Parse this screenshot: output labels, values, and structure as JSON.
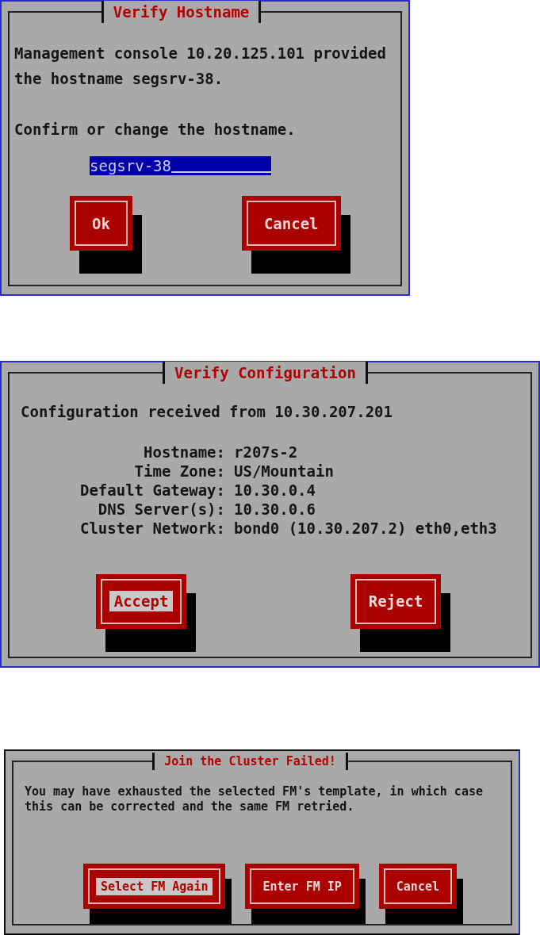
{
  "dialogs": [
    {
      "title": "Verify Hostname",
      "message": "Management console 10.20.125.101 provided the hostname segsrv-38.",
      "prompt": "Confirm or change the hostname.",
      "field": {
        "value": "segsrv-38"
      },
      "buttons": [
        {
          "label": "Ok",
          "selected": false
        },
        {
          "label": "Cancel",
          "selected": false
        }
      ]
    },
    {
      "title": "Verify Configuration",
      "message": "Configuration received from 10.30.207.201",
      "rows": [
        {
          "label": "Hostname:",
          "value": "r207s-2"
        },
        {
          "label": "Time Zone:",
          "value": "US/Mountain"
        },
        {
          "label": "Default Gateway:",
          "value": "10.30.0.4"
        },
        {
          "label": "DNS Server(s):",
          "value": "10.30.0.6"
        },
        {
          "label": "Cluster Network:",
          "value": "bond0 (10.30.207.2) eth0,eth3"
        }
      ],
      "buttons": [
        {
          "label": "Accept",
          "selected": true
        },
        {
          "label": "Reject",
          "selected": false
        }
      ]
    },
    {
      "title": "Join the Cluster Failed!",
      "message": "You may have exhausted the selected FM's template, in which case this can be corrected and the same FM retried.",
      "buttons": [
        {
          "label": "Select FM Again",
          "selected": true
        },
        {
          "label": "Enter FM IP",
          "selected": false
        },
        {
          "label": "Cancel",
          "selected": false
        }
      ]
    }
  ]
}
